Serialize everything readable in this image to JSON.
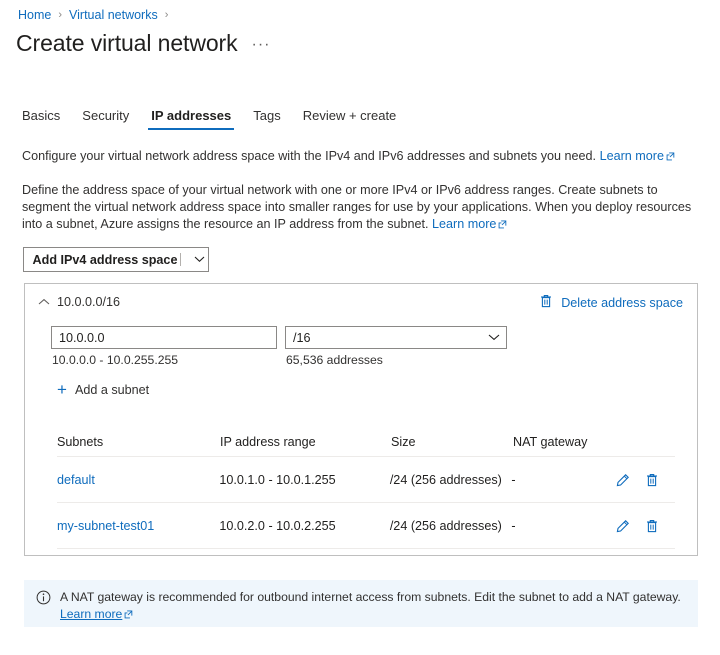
{
  "breadcrumb": {
    "items": [
      {
        "label": "Home"
      },
      {
        "label": "Virtual networks"
      }
    ],
    "separator": "›"
  },
  "header": {
    "title": "Create virtual network",
    "ellipsis": "···"
  },
  "tabs": [
    {
      "label": "Basics",
      "active": false
    },
    {
      "label": "Security",
      "active": false
    },
    {
      "label": "IP addresses",
      "active": true
    },
    {
      "label": "Tags",
      "active": false
    },
    {
      "label": "Review + create",
      "active": false
    }
  ],
  "intro": {
    "paragraph1": "Configure your virtual network address space with the IPv4 and IPv6 addresses and subnets you need.",
    "paragraph1_link": "Learn more",
    "paragraph2": "Define the address space of your virtual network with one or more IPv4 or IPv6 address ranges. Create subnets to segment the virtual network address space into smaller ranges for use by your applications. When you deploy resources into a subnet, Azure assigns the resource an IP address from the subnet.",
    "paragraph2_link": "Learn more"
  },
  "toolbar": {
    "add_ipv4_label": "Add IPv4 address space"
  },
  "address_space": {
    "cidr": "10.0.0.0/16",
    "delete_label": "Delete address space",
    "address_value": "10.0.0.0",
    "address_placeholder": "10.0.0.0",
    "prefix_value": "/16",
    "range_hint": "10.0.0.0 - 10.0.255.255",
    "count_hint": "65,536 addresses",
    "add_subnet_label": "Add a subnet"
  },
  "subnet_table": {
    "columns": {
      "name": "Subnets",
      "range": "IP address range",
      "size": "Size",
      "nat": "NAT gateway"
    },
    "rows": [
      {
        "name": "default",
        "range": "10.0.1.0 - 10.0.1.255",
        "size": "/24 (256 addresses)",
        "nat": "-"
      },
      {
        "name": "my-subnet-test01",
        "range": "10.0.2.0 - 10.0.2.255",
        "size": "/24 (256 addresses)",
        "nat": "-"
      }
    ]
  },
  "info_banner": {
    "text": "A NAT gateway is recommended for outbound internet access from subnets. Edit the subnet to add a NAT gateway.",
    "link": "Learn more"
  },
  "colors": {
    "accent": "#0f6cbd",
    "info_background": "#eff6fc",
    "card_border": "#bfbfbf",
    "text": "#201f1e"
  }
}
